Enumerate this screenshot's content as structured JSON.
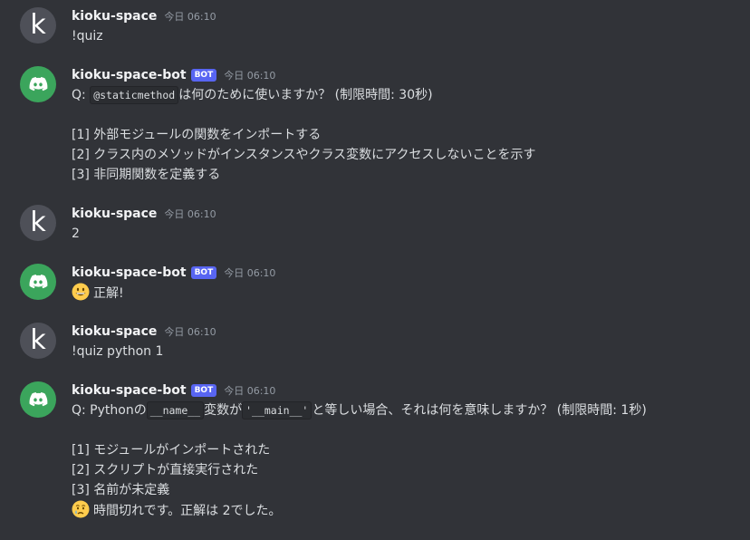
{
  "colors": {
    "background": "#313338",
    "bot_avatar": "#3ba55c",
    "user_avatar": "#4e5058",
    "bot_tag": "#5865f2"
  },
  "users": {
    "user_name": "kioku-space",
    "user_initial": "k",
    "bot_name": "kioku-space-bot",
    "bot_tag": "BOT"
  },
  "messages": [
    {
      "author": "kioku-space",
      "timestamp": "今日 06:10",
      "text": "!quiz"
    },
    {
      "author": "kioku-space-bot",
      "tag": "BOT",
      "timestamp": "今日 06:10",
      "question_prefix": "Q: ",
      "question_code": "@staticmethod",
      "question_suffix": "は何のために使いますか？ (制限時間: 30秒)",
      "options": [
        "[1] 外部モジュールの関数をインポートする",
        "[2] クラス内のメソッドがインスタンスやクラス変数にアクセスしないことを示す",
        "[3] 非同期関数を定義する"
      ]
    },
    {
      "author": "kioku-space",
      "timestamp": "今日 06:10",
      "text": "2"
    },
    {
      "author": "kioku-space-bot",
      "tag": "BOT",
      "timestamp": "今日 06:10",
      "emoji": "grinning-face",
      "text": "正解!"
    },
    {
      "author": "kioku-space",
      "timestamp": "今日 06:10",
      "text": "!quiz python 1"
    },
    {
      "author": "kioku-space-bot",
      "tag": "BOT",
      "timestamp": "今日 06:10",
      "question_prefix": "Q: Pythonの",
      "question_code1": "__name__",
      "question_mid": "変数が",
      "question_code2": "'__main__'",
      "question_suffix": "と等しい場合、それは何を意味しますか？ (制限時間: 1秒)",
      "options": [
        "[1] モジュールがインポートされた",
        "[2] スクリプトが直接実行された",
        "[3] 名前が未定義"
      ],
      "timeout_emoji": "crying-face",
      "timeout_text": "時間切れです。正解は 2でした。"
    }
  ]
}
